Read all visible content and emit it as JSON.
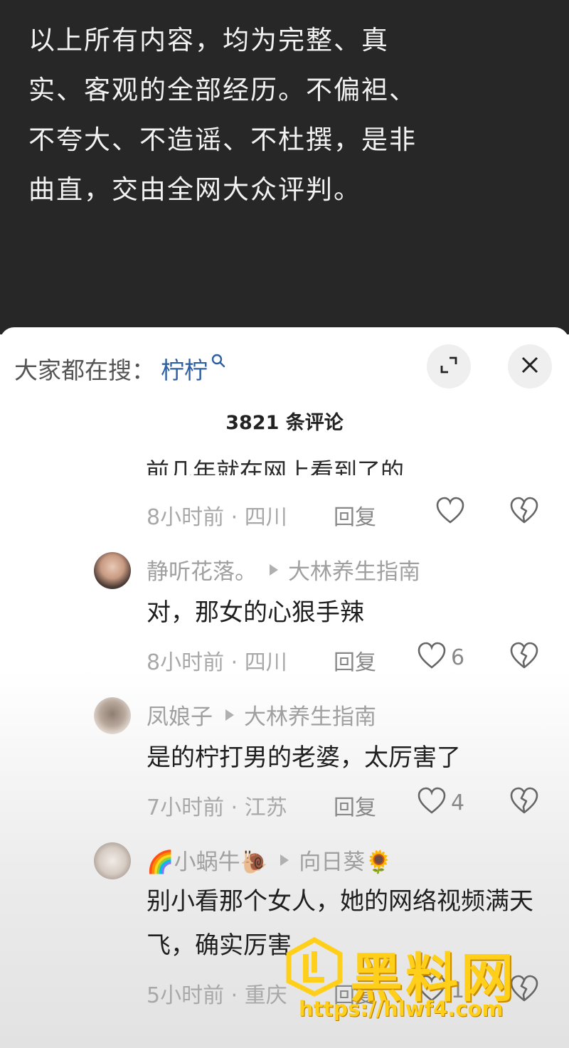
{
  "post_text": "以上所有内容，均为完整、真实、客观的全部经历。不偏袒、不夸大、不造谣、不杜撰，是非曲直，交由全网大众评判。",
  "search_bar": {
    "label": "大家都在搜：",
    "term": "柠柠"
  },
  "comments_header": {
    "count_label": "3821 条评论"
  },
  "clipped_comment": {
    "text": "前几年就在网上看到了的",
    "time_location": "8小时前 · 四川",
    "reply_label": "回复",
    "likes": ""
  },
  "comments": [
    {
      "username": "静听花落。",
      "reply_to": "大林养生指南",
      "text": "对，那女的心狠手辣",
      "time_location": "8小时前 · 四川",
      "reply_label": "回复",
      "likes": "6"
    },
    {
      "username": "凤娘子",
      "reply_to": "大林养生指南",
      "text": "是的柠打男的老婆，太厉害了",
      "time_location": "7小时前 · 江苏",
      "reply_label": "回复",
      "likes": "4"
    },
    {
      "username": "🌈小蜗牛🐌",
      "reply_to": "向日葵🌻",
      "text": "别小看那个女人，她的网络视频满天飞，确实厉害",
      "time_location": "5小时前 · 重庆",
      "reply_label": "回复",
      "likes": "1"
    }
  ],
  "watermark": {
    "title": "黑料网",
    "url": "https://hlwf4.com"
  },
  "colors": {
    "dark_panel": "#272727",
    "search_term": "#2f5fa3",
    "watermark": "#ffcf1a"
  },
  "icons": [
    "search-icon",
    "expand-icon",
    "close-icon",
    "heart-icon",
    "broken-heart-icon",
    "play-arrow-icon"
  ]
}
